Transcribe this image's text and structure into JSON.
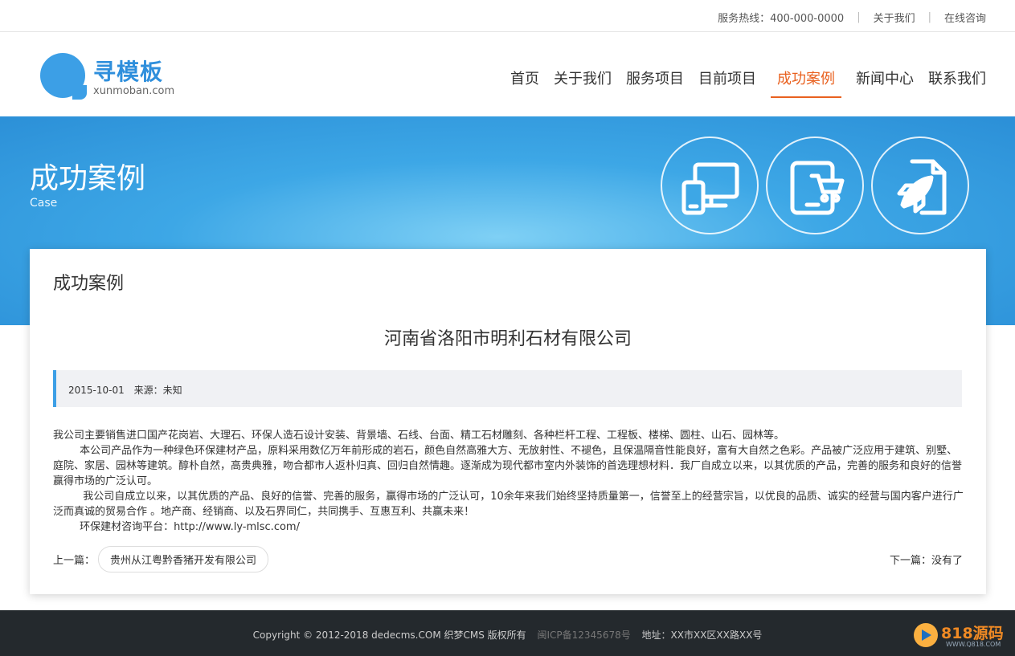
{
  "topbar": {
    "hotline": "服务热线：400-000-0000",
    "about": "关于我们",
    "consult": "在线咨询"
  },
  "logo": {
    "name": "寻模板",
    "domain": "xunmoban.com"
  },
  "nav": {
    "items": [
      "首页",
      "关于我们",
      "服务项目",
      "目前项目",
      "成功案例",
      "新闻中心",
      "联系我们"
    ],
    "active": "成功案例"
  },
  "banner": {
    "title": "成功案例",
    "subtitle": "Case",
    "icons": [
      "devices-icon",
      "tablet-cart-icon",
      "rocket-document-icon"
    ]
  },
  "article": {
    "section_title": "成功案例",
    "title": "河南省洛阳市明利石材有限公司",
    "date": "2015-10-01",
    "source": "来源：未知",
    "paragraphs": [
      "我公司主要销售进口国产花岗岩、大理石、环保人造石设计安装、背景墙、石线、台面、精工石材雕刻、各种栏杆工程、工程板、楼梯、圆柱、山石、园林等。",
      "        本公司产品作为一种绿色环保建材产品，原料采用数亿万年前形成的岩石，颜色自然高雅大方、无放射性、不褪色，且保温隔音性能良好，富有大自然之色彩。产品被广泛应用于建筑、别墅、庭院、家居、园林等建筑。醇朴自然，高贵典雅，吻合都市人返朴归真、回归自然情趣。逐渐成为现代都市室内外装饰的首选理想材料．我厂自成立以来，以其优质的产品，完善的服务和良好的信誉赢得市场的广泛认可。",
      "         我公司自成立以来，以其优质的产品、良好的信誉、完善的服务，赢得市场的广泛认可，10余年来我们始终坚持质量第一，信誉至上的经营宗旨，以优良的品质、诚实的经营与国内客户进行广泛而真诚的贸易合作 。地产商、经销商、以及石界同仁，共同携手、互惠互利、共赢未来！",
      "        环保建材咨询平台：http://www.ly-mlsc.com/"
    ],
    "prev_label": "上一篇：",
    "prev_link": "贵州从江粤黔香猪开发有限公司",
    "next_text": "下一篇：没有了"
  },
  "footer": {
    "copyright": "Copyright © 2012-2018 dedecms.COM 织梦CMS 版权所有",
    "icp": "闽ICP备12345678号",
    "address": "地址：XX市XX区XX路XX号",
    "watermark_main": "818源码",
    "watermark_sub": "WWW.Q818.COM"
  },
  "colors": {
    "brand_blue": "#3c9fe6",
    "active_orange": "#e9611f",
    "footer_bg": "#24292d"
  }
}
